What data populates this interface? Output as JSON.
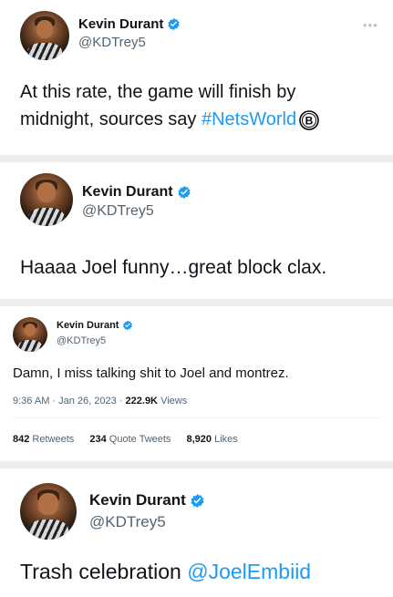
{
  "tweets": [
    {
      "name": "Kevin Durant",
      "handle": "@KDTrey5",
      "text": "At this rate, the game will finish by",
      "text2": "midnight, sources say ",
      "hashtag": "#NetsWorld",
      "more_icon": "ellipsis-icon"
    },
    {
      "name": "Kevin Durant",
      "handle": "@KDTrey5",
      "text": "Haaaa Joel funny…great block clax."
    },
    {
      "name": "Kevin Durant",
      "handle": "@KDTrey5",
      "text": "Damn, I miss talking shit to Joel and montrez.",
      "time": "9:36 AM · Jan 26, 2023 · ",
      "views_count": "222.9K",
      "views_label": " Views",
      "retweets_count": "842",
      "retweets_label": " Retweets",
      "quotes_count": "234",
      "quotes_label": " Quote Tweets",
      "likes_count": "8,920",
      "likes_label": " Likes"
    },
    {
      "name": "Kevin Durant",
      "handle": "@KDTrey5",
      "text": "Trash celebration ",
      "mention": "@JoelEmbiid"
    }
  ],
  "colors": {
    "link": "#1d9bf0",
    "verified": "#1d9bf0",
    "secondary": "#536471"
  }
}
